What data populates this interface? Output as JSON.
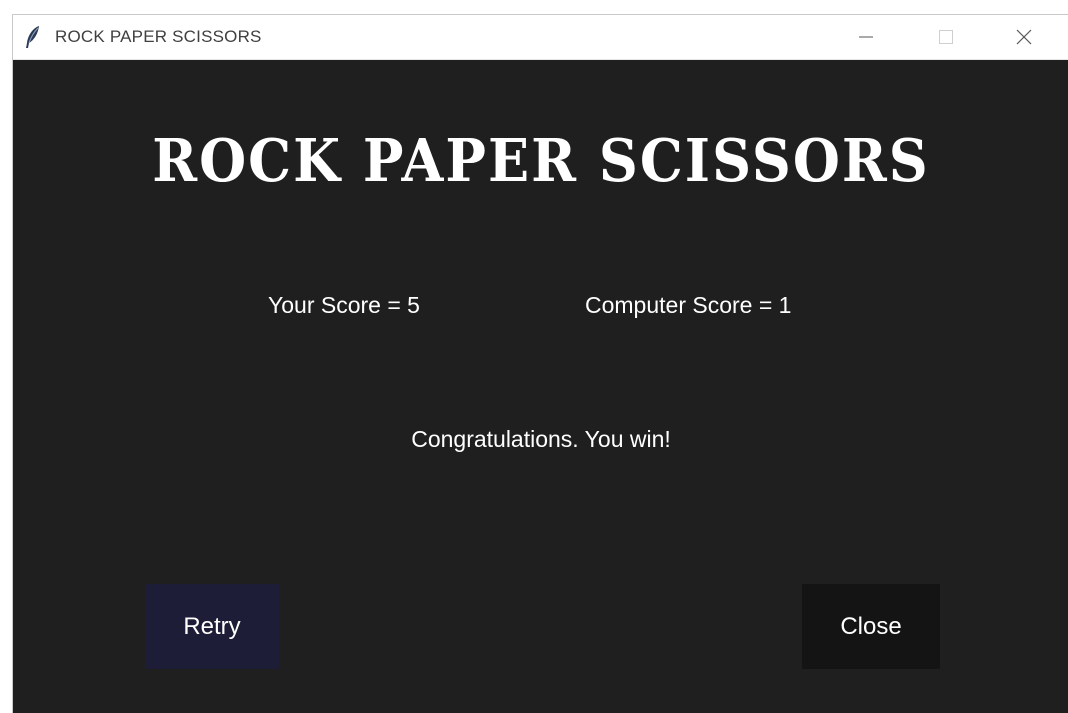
{
  "window": {
    "title": "ROCK PAPER SCISSORS",
    "app_icon": "feather-icon",
    "controls": [
      "minimize-icon",
      "maximize-icon",
      "close-icon"
    ]
  },
  "game": {
    "title": "ROCK PAPER SCISSORS",
    "your_score_text": "Your Score = 5",
    "computer_score_text": "Computer Score = 1",
    "result_message": "Congratulations. You win!",
    "retry_label": "Retry",
    "close_label": "Close"
  },
  "colors": {
    "background": "#1f1f1f",
    "text": "#ffffff",
    "retry_button": "#1d1d37",
    "close_button": "#141414",
    "titlebar": "#ffffff"
  }
}
